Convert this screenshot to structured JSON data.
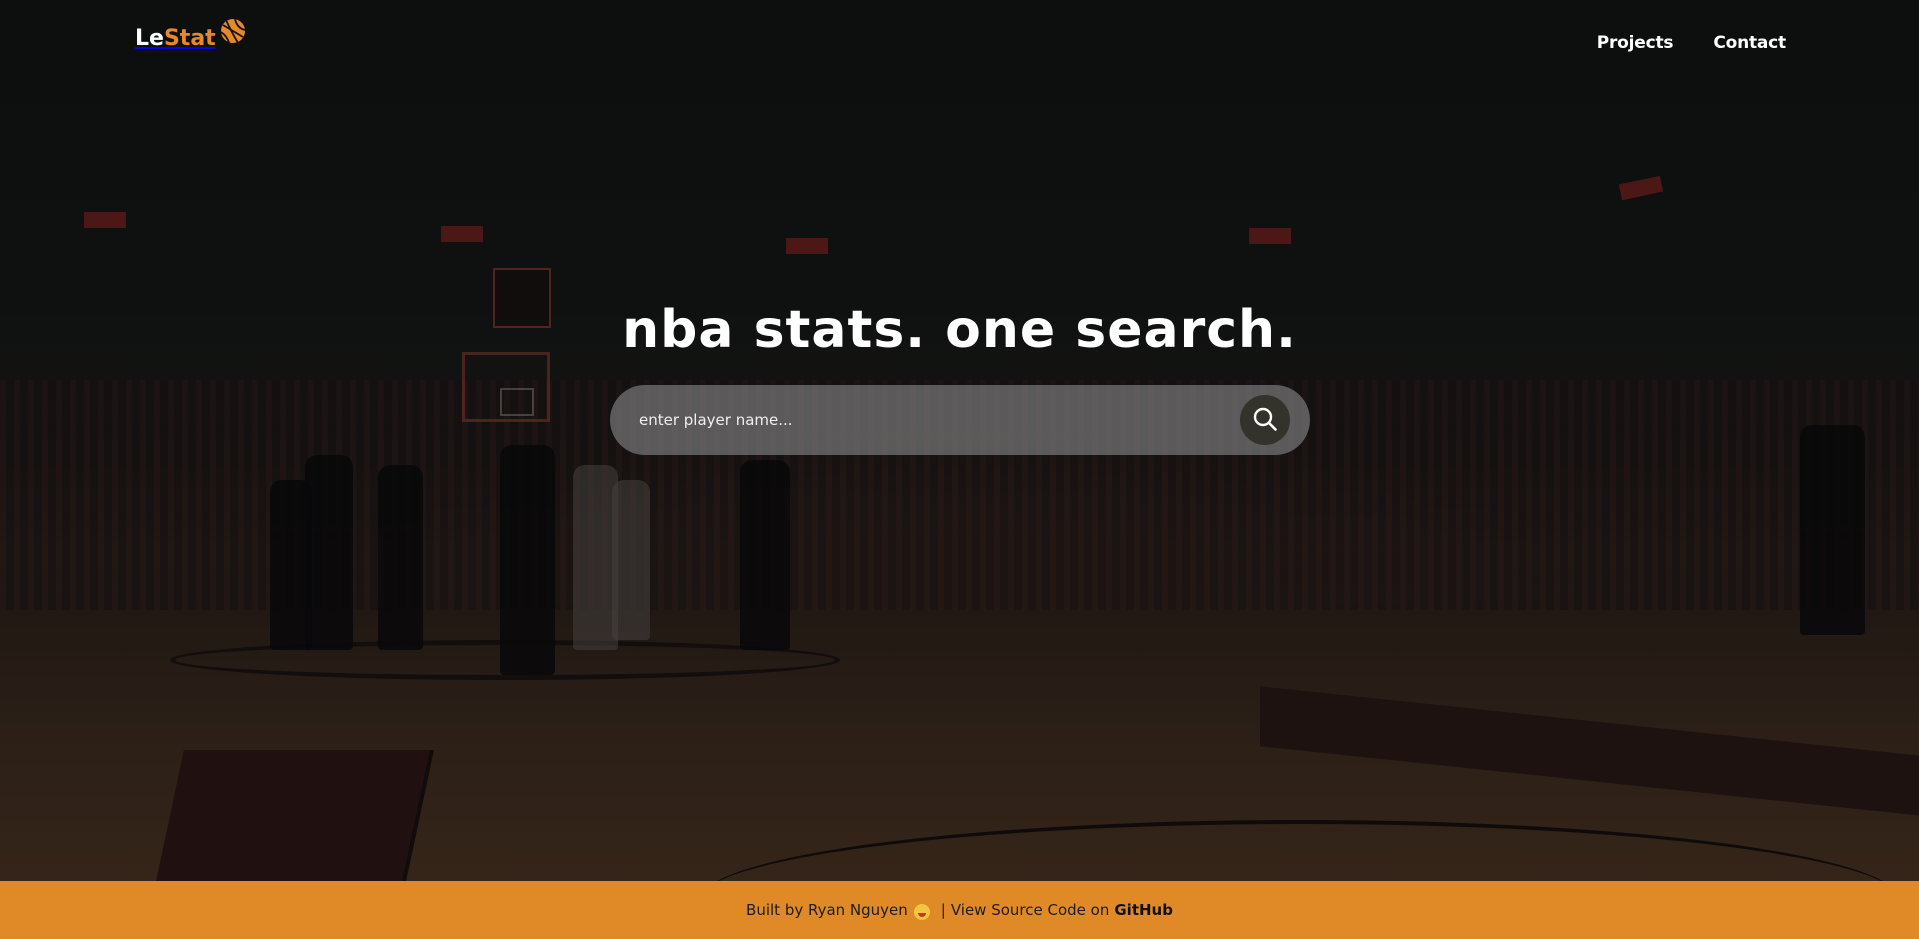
{
  "header": {
    "logo": {
      "part1": "Le",
      "part2": "Stat",
      "icon": "basketball-icon"
    },
    "nav": [
      {
        "label": "Projects"
      },
      {
        "label": "Contact"
      }
    ]
  },
  "hero": {
    "title": "nba stats. one search.",
    "search": {
      "placeholder": "enter player name...",
      "icon": "search-icon"
    }
  },
  "footer": {
    "built_by": "Built by Ryan Nguyen",
    "emoji": "tongue-out-emoji",
    "separator": "|",
    "view_source": "View Source Code on",
    "github": "GitHub"
  },
  "colors": {
    "accent": "#e5892a",
    "footer_bg": "#e08a27",
    "search_bg": "#707070",
    "search_button": "#33322b"
  }
}
